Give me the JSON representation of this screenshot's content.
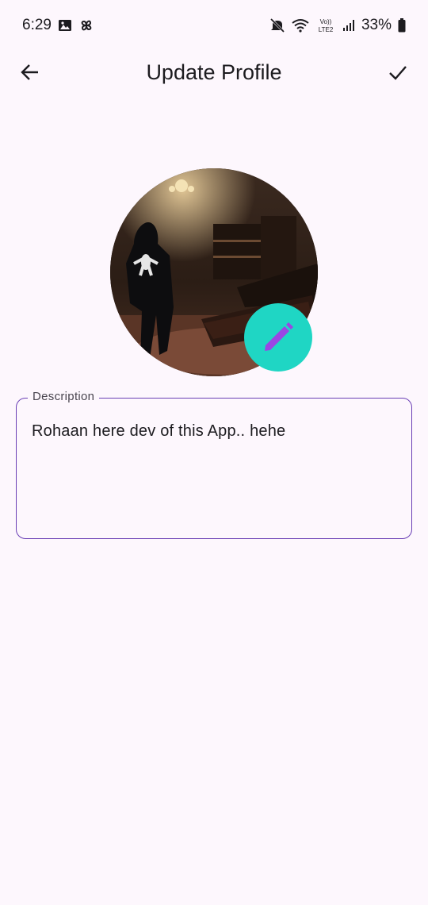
{
  "status_bar": {
    "time": "6:29",
    "battery": "33%",
    "icons": [
      "gallery-icon",
      "pinwheel-icon",
      "mute-icon",
      "wifi-icon",
      "volte-icon",
      "signal-icon",
      "battery-icon"
    ],
    "volte_top": "Vo))",
    "volte_bottom": "LTE2"
  },
  "app_bar": {
    "title": "Update Profile",
    "back_icon": "arrow-back-icon",
    "confirm_icon": "check-icon"
  },
  "profile": {
    "edit_icon": "pencil-icon",
    "fab_color": "#1fd6c4",
    "pencil_color": "#9b45e4"
  },
  "description": {
    "label": "Description",
    "value": "Rohaan here dev of this App.. hehe",
    "border_color": "#6a3fb5"
  }
}
